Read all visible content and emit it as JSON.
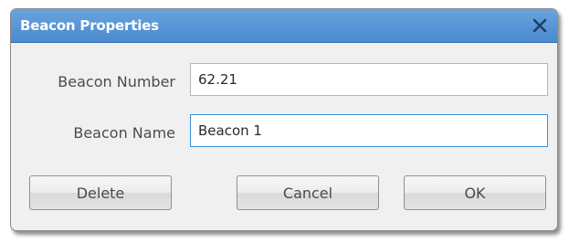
{
  "dialog": {
    "title": "Beacon Properties",
    "close_icon": "close-x-icon",
    "fields": {
      "beacon_number": {
        "label": "Beacon Number",
        "value": "62.21"
      },
      "beacon_name": {
        "label": "Beacon Name",
        "value": "Beacon 1"
      }
    },
    "buttons": {
      "delete": "Delete",
      "cancel": "Cancel",
      "ok": "OK"
    }
  },
  "colors": {
    "titlebar": "#4a8ad0",
    "focus_border": "#3a8fdc",
    "dialog_background": "#f0f0f0"
  }
}
